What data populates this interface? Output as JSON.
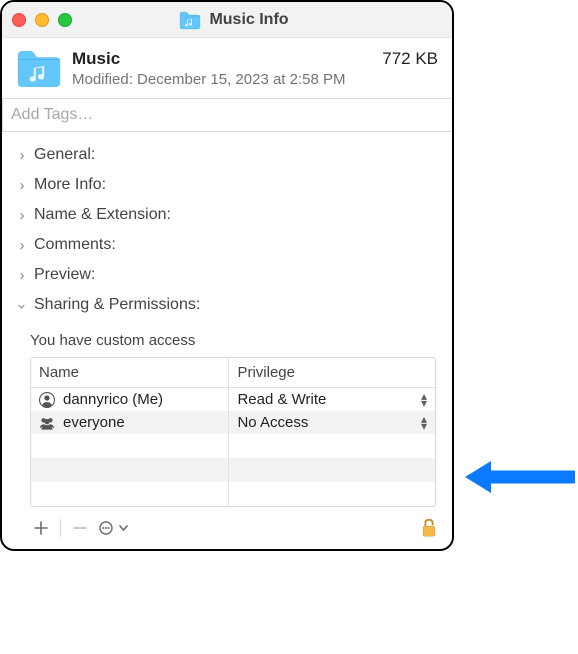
{
  "window": {
    "title": "Music Info"
  },
  "header": {
    "name": "Music",
    "size": "772 KB",
    "modified_label": "Modified: December 15, 2023 at 2:58 PM"
  },
  "tags": {
    "placeholder": "Add Tags…"
  },
  "sections": {
    "general": "General:",
    "more_info": "More Info:",
    "name_ext": "Name & Extension:",
    "comments": "Comments:",
    "preview": "Preview:",
    "sharing": "Sharing & Permissions:"
  },
  "permissions": {
    "access_note": "You have custom access",
    "columns": {
      "name": "Name",
      "privilege": "Privilege"
    },
    "rows": [
      {
        "icon": "person-icon",
        "name": "dannyrico (Me)",
        "privilege": "Read & Write"
      },
      {
        "icon": "group-icon",
        "name": "everyone",
        "privilege": "No Access"
      }
    ]
  }
}
